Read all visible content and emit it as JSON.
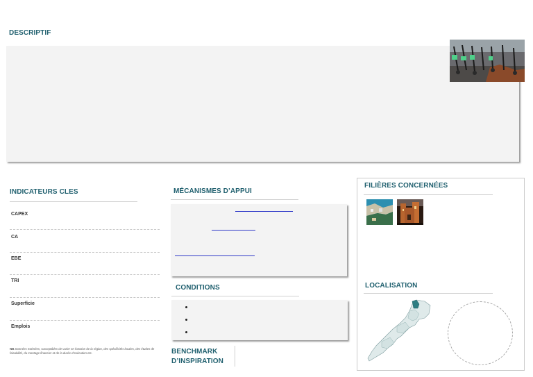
{
  "sections": {
    "descriptif": "DESCRIPTIF",
    "indicateurs": "INDICATEURS CLES",
    "mecanismes": "MÉCANISMES D’APPUI",
    "conditions": "CONDITIONS",
    "benchmark_line1": "BENCHMARK",
    "benchmark_line2": "D’INSPIRATION",
    "filieres": "FILIÈRES CONCERNÉES",
    "localisation": "LOCALISATION"
  },
  "indicators": [
    "CAPEX",
    "CA",
    "EBE",
    "TRI",
    "Superficie",
    "Emplois"
  ],
  "note": {
    "prefix": "NB",
    "text": "Données estimées, susceptibles de varier en fonction de la région, des spécificités locales, des études de faisabilité, du montage financier et de la durée d’exécution etc."
  },
  "images": {
    "header_photo": "electric-scooters-photo",
    "filiere_1": "coastal-city-photo",
    "filiere_2": "kasbah-photo",
    "map": "morocco-map"
  },
  "colors": {
    "title": "#1f5f6e",
    "panel": "#f3f3f3",
    "link": "#2b35c8",
    "map_fill": "#dfeaea",
    "map_highlight": "#2f7e82"
  }
}
